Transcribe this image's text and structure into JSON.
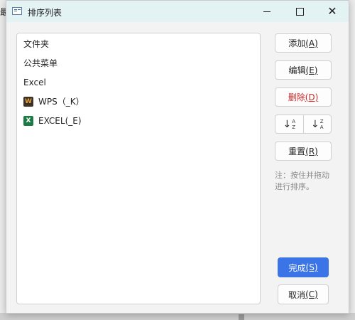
{
  "background": {
    "fragment_text": "最"
  },
  "titlebar": {
    "app_icon": "document-window-icon",
    "title": "排序列表",
    "minimize_icon": "minimize-icon",
    "maximize_icon": "maximize-icon",
    "close_icon": "close-icon",
    "close_glyph": "✕"
  },
  "list": {
    "items": [
      {
        "label": "文件夹",
        "icon": ""
      },
      {
        "label": "公共菜单",
        "icon": ""
      },
      {
        "label": "Excel",
        "icon": ""
      },
      {
        "label": "WPS（_K）",
        "icon": "wps-icon",
        "icon_glyph": "W"
      },
      {
        "label": "EXCEL(_E)",
        "icon": "excel-icon",
        "icon_glyph": "X"
      }
    ]
  },
  "buttons": {
    "add": {
      "label": "添加",
      "hotkey": "(A)"
    },
    "edit": {
      "label": "编辑",
      "hotkey": "(E)"
    },
    "delete": {
      "label": "删除",
      "hotkey": "(D)"
    },
    "sort_asc": {
      "arrow": "↓",
      "top": "A",
      "bottom": "Z"
    },
    "sort_desc": {
      "arrow": "↓",
      "top": "Z",
      "bottom": "A"
    },
    "reset": {
      "label": "重置",
      "hotkey": "(R)"
    },
    "done": {
      "label": "完成",
      "hotkey": "(S)"
    },
    "cancel": {
      "label": "取消",
      "hotkey": "(C)"
    }
  },
  "note": {
    "line1": "注：按住并拖动",
    "line2": "进行排序。"
  },
  "colors": {
    "titlebar": "#e3f2f3",
    "primary": "#3b74e6",
    "danger": "#d22d2d"
  }
}
